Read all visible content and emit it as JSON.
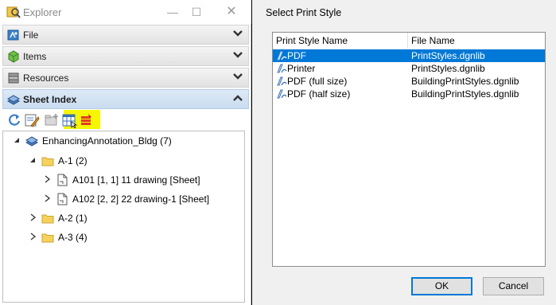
{
  "explorer": {
    "title": "Explorer",
    "sections": [
      {
        "label": "File"
      },
      {
        "label": "Items"
      },
      {
        "label": "Resources"
      },
      {
        "label": "Sheet Index"
      }
    ],
    "tree": {
      "root": "EnhancingAnnotation_Bldg (7)",
      "folders": [
        {
          "label": "A-1 (2)",
          "sheets": [
            "A101 [1, 1] 11 drawing [Sheet]",
            "A102 [2, 2] 22 drawing-1 [Sheet]"
          ]
        },
        {
          "label": "A-2 (1)"
        },
        {
          "label": "A-3 (4)"
        }
      ]
    }
  },
  "dialog": {
    "title": "Select Print Style",
    "columns": [
      "Print Style Name",
      "File Name"
    ],
    "rows": [
      {
        "name": "PDF",
        "file": "PrintStyles.dgnlib"
      },
      {
        "name": "Printer",
        "file": "PrintStyles.dgnlib"
      },
      {
        "name": "PDF (full size)",
        "file": "BuildingPrintStyles.dgnlib"
      },
      {
        "name": "PDF (half size)",
        "file": "BuildingPrintStyles.dgnlib"
      }
    ],
    "ok_label": "OK",
    "cancel_label": "Cancel"
  },
  "colors": {
    "selection": "#0078d7",
    "highlight": "#f6f600",
    "active_section": "#c9dcf0"
  }
}
